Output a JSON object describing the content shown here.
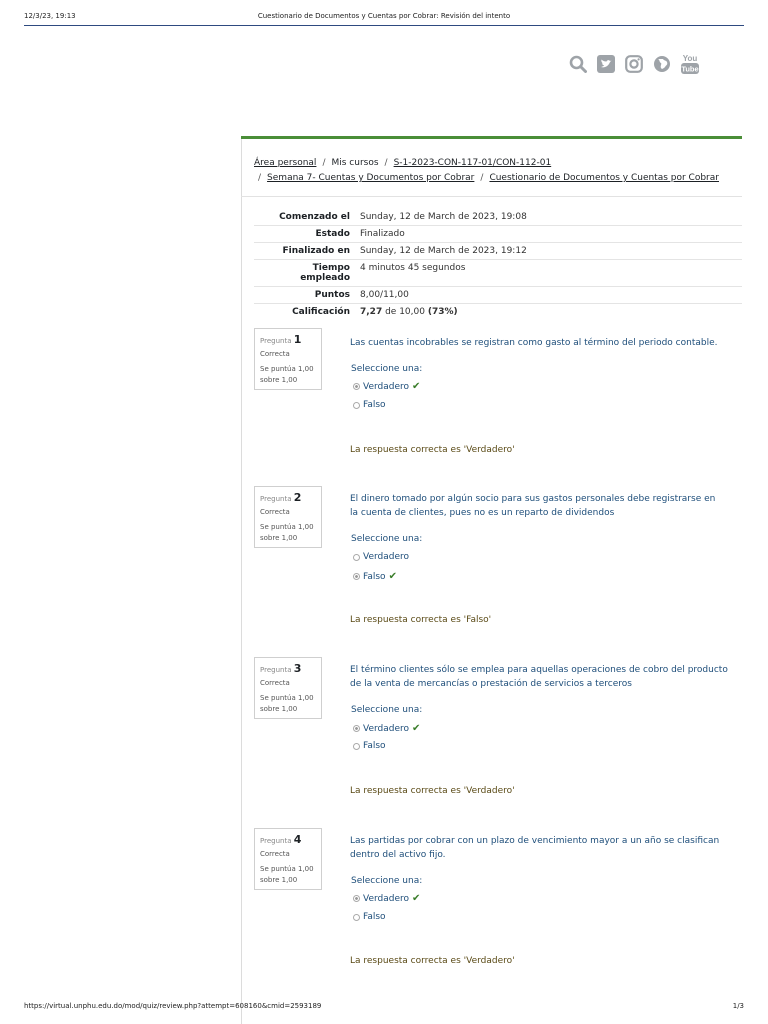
{
  "print_header": {
    "datetime": "12/3/23, 19:13",
    "title": "Cuestionario de Documentos y Cuentas por Cobrar: Revisión del intento"
  },
  "social_icons": [
    "search-icon",
    "twitter-icon",
    "instagram-icon",
    "globe-icon",
    "youtube-icon"
  ],
  "breadcrumb": {
    "items": [
      "Área personal",
      "Mis cursos",
      "S-1-2023-CON-117-01/CON-112-01",
      "Semana 7- Cuentas y Documentos por Cobrar",
      "Cuestionario de Documentos y Cuentas por Cobrar"
    ]
  },
  "summary": {
    "started_label": "Comenzado el",
    "started_value": "Sunday, 12 de March de 2023, 19:08",
    "state_label": "Estado",
    "state_value": "Finalizado",
    "finished_label": "Finalizado en",
    "finished_value": "Sunday, 12 de March de 2023, 19:12",
    "time_label_1": "Tiempo",
    "time_label_2": "empleado",
    "time_value": "4 minutos 45 segundos",
    "points_label": "Puntos",
    "points_value": "8,00/11,00",
    "grade_label": "Calificación",
    "grade_score": "7,27",
    "grade_of": " de 10,00 ",
    "grade_pct": "(73%)"
  },
  "questions": [
    {
      "prefix": "Pregunta",
      "number": "1",
      "status": "Correcta",
      "points_1": "Se puntúa 1,00",
      "points_2": "sobre 1,00",
      "text": "Las cuentas incobrables se registran como gasto al término del periodo contable.",
      "select_label": "Seleccione una:",
      "options": [
        "Verdadero",
        "Falso"
      ],
      "feedback": "La respuesta correcta es 'Verdadero'"
    },
    {
      "prefix": "Pregunta",
      "number": "2",
      "status": "Correcta",
      "points_1": "Se puntúa 1,00",
      "points_2": "sobre 1,00",
      "text": " El dinero tomado por algún socio para sus gastos personales debe registrarse en la cuenta de clientes, pues no es un reparto de dividendos",
      "select_label": "Seleccione una:",
      "options": [
        "Verdadero",
        "Falso"
      ],
      "feedback": "La respuesta correcta es 'Falso'"
    },
    {
      "prefix": "Pregunta",
      "number": "3",
      "status": "Correcta",
      "points_1": "Se puntúa 1,00",
      "points_2": "sobre 1,00",
      "text": "El término clientes sólo se emplea para aquellas operaciones de cobro del producto de la venta de mercancías o prestación de servicios a terceros",
      "select_label": "Seleccione una:",
      "options": [
        "Verdadero",
        "Falso"
      ],
      "feedback": "La respuesta correcta es 'Verdadero'"
    },
    {
      "prefix": "Pregunta",
      "number": "4",
      "status": "Correcta",
      "points_1": "Se puntúa 1,00",
      "points_2": "sobre 1,00",
      "text": "Las partidas por cobrar con un plazo de vencimiento mayor a un año se clasifican dentro del activo fijo.",
      "select_label": "Seleccione una:",
      "options": [
        "Verdadero",
        "Falso"
      ],
      "feedback": "La respuesta correcta es 'Verdadero'"
    }
  ],
  "footer": {
    "url": "https://virtual.unphu.edu.do/mod/quiz/review.php?attempt=608160&cmid=2593189",
    "page": "1/3"
  }
}
